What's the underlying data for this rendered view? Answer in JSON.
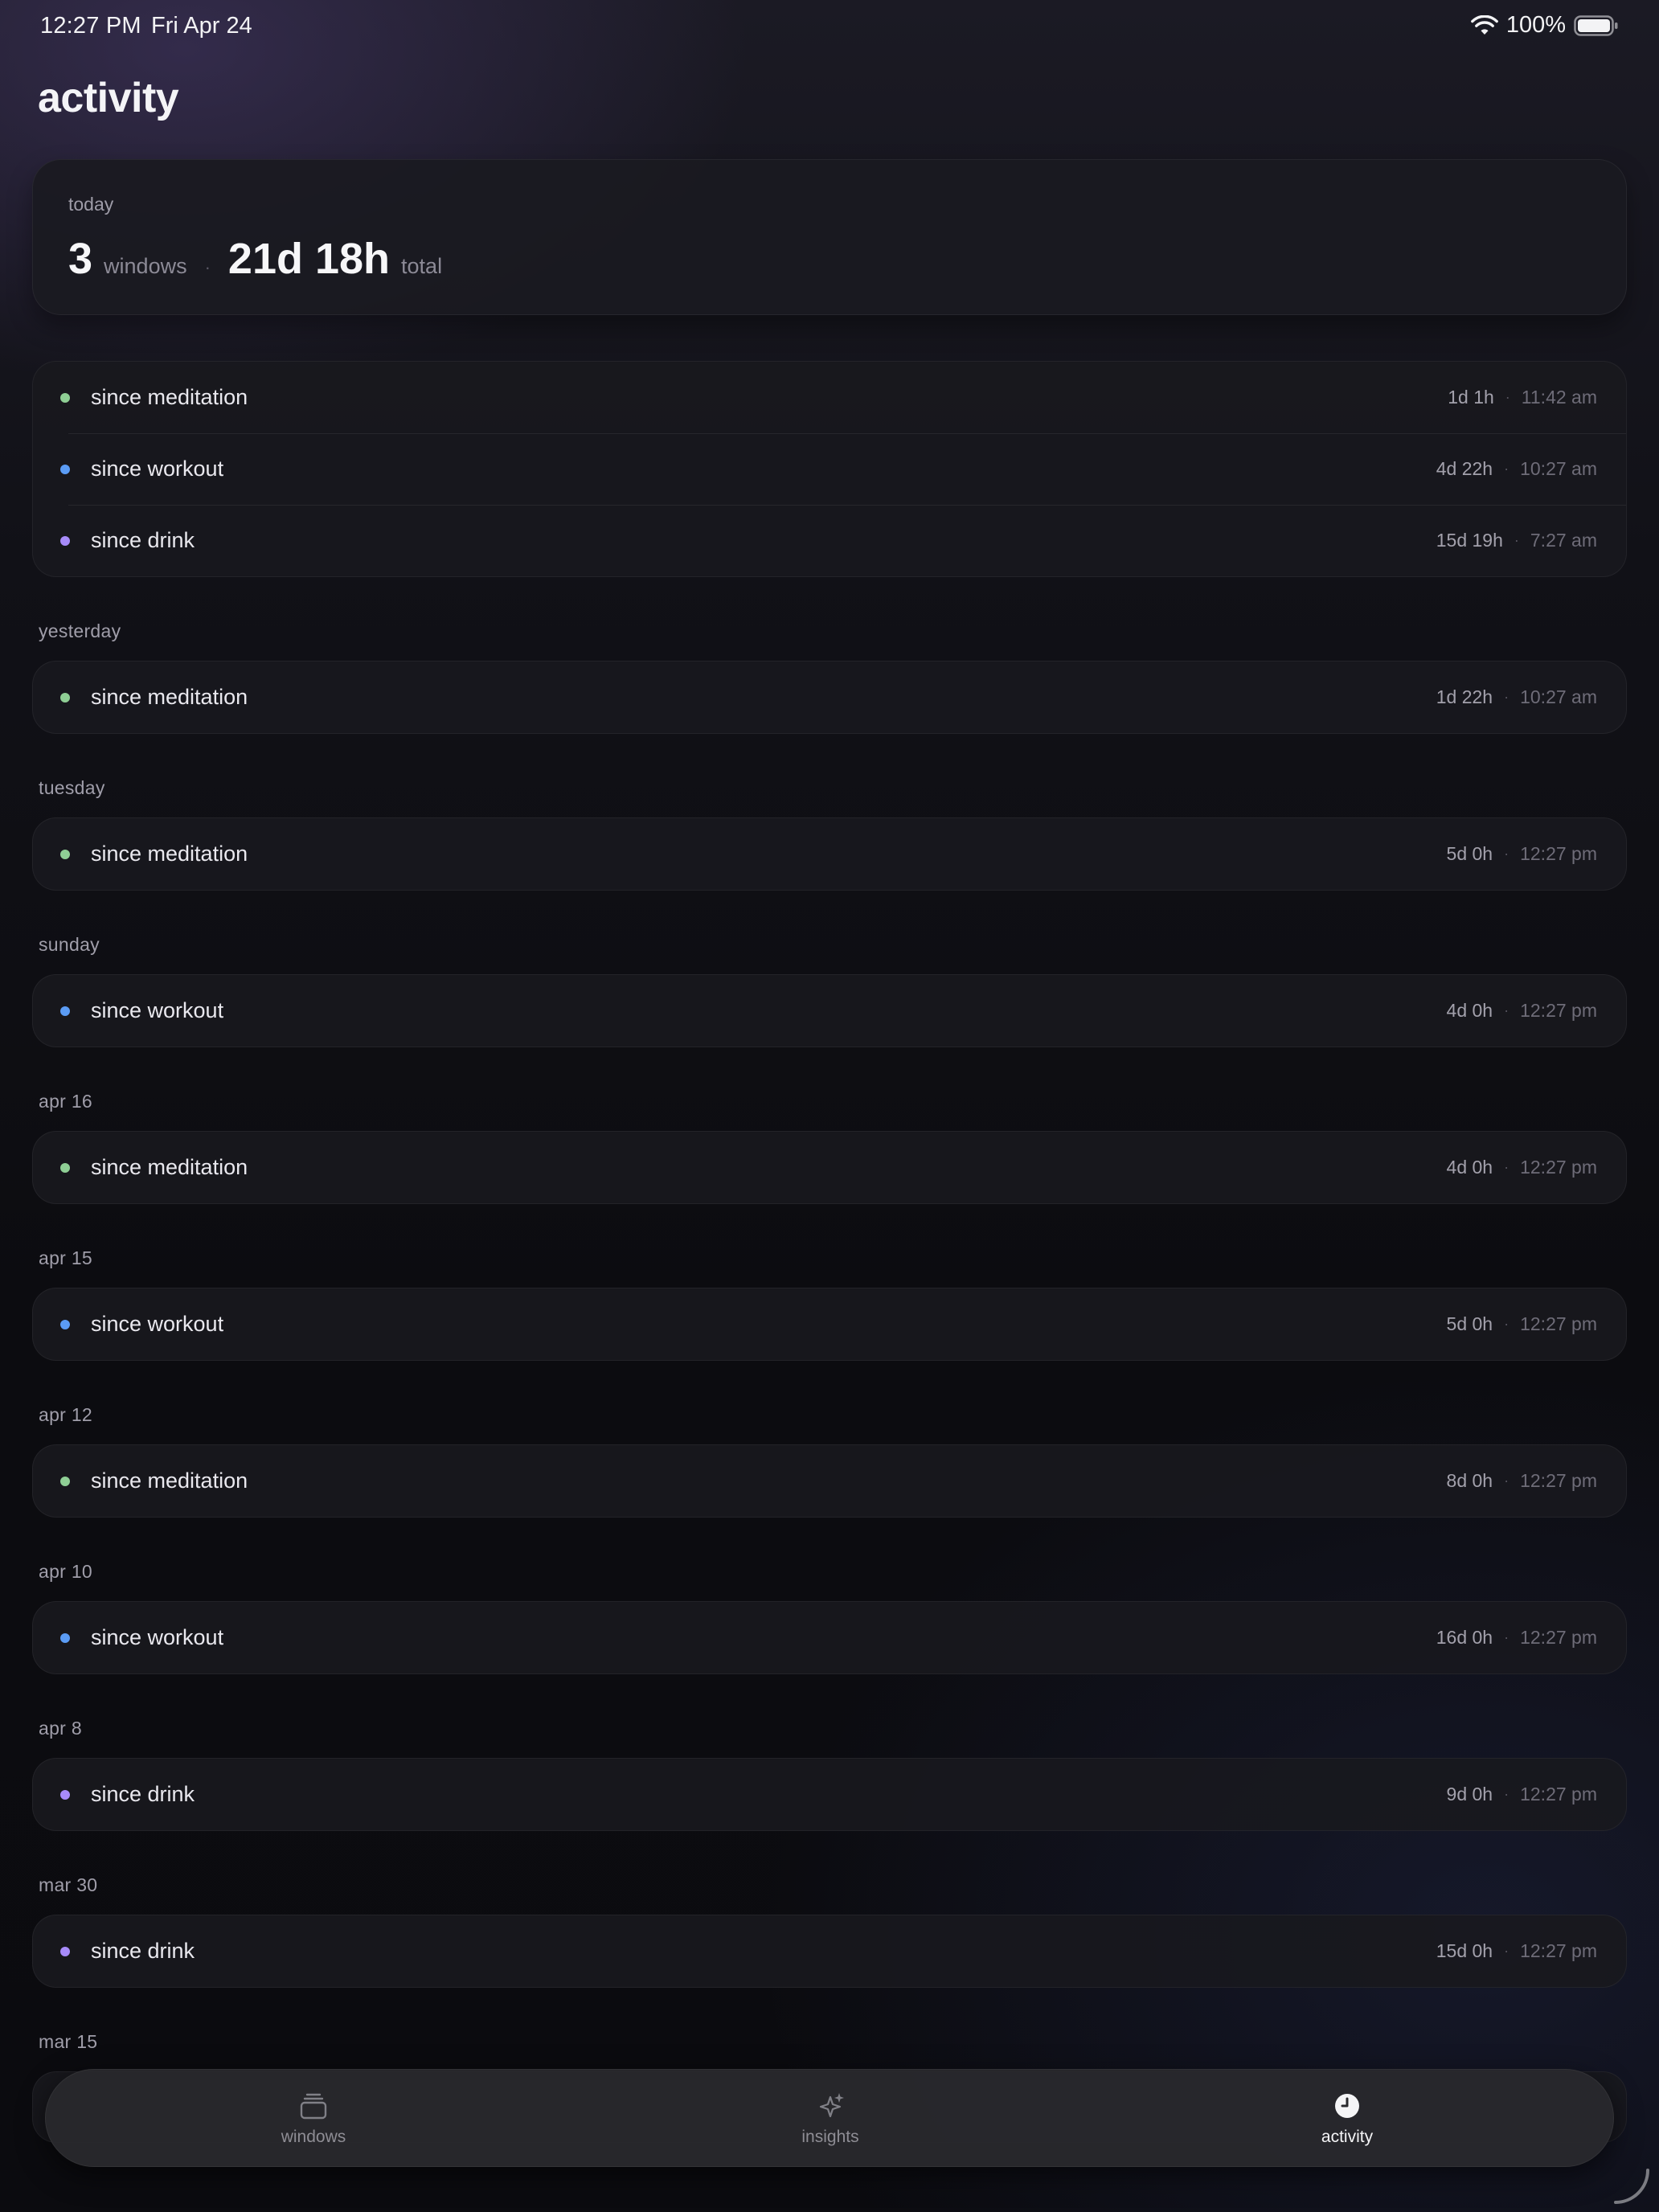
{
  "status_bar": {
    "time": "12:27 PM",
    "date": "Fri Apr 24",
    "battery_pct": "100%",
    "icons": [
      "wifi-icon",
      "battery-icon"
    ]
  },
  "page": {
    "title": "activity"
  },
  "summary": {
    "label": "today",
    "windows_count": "3",
    "windows_unit": "windows",
    "separator": "·",
    "total": "21d 18h",
    "total_unit": "total"
  },
  "colors": {
    "meditation": "#8fcf95",
    "workout": "#5b9cf5",
    "drink": "#a78bfa"
  },
  "sections": [
    {
      "header": "",
      "rows": [
        {
          "label": "since meditation",
          "duration": "1d 1h",
          "time": "11:42 am",
          "kind": "meditation"
        },
        {
          "label": "since workout",
          "duration": "4d 22h",
          "time": "10:27 am",
          "kind": "workout"
        },
        {
          "label": "since drink",
          "duration": "15d 19h",
          "time": "7:27 am",
          "kind": "drink"
        }
      ]
    },
    {
      "header": "yesterday",
      "rows": [
        {
          "label": "since meditation",
          "duration": "1d 22h",
          "time": "10:27 am",
          "kind": "meditation"
        }
      ]
    },
    {
      "header": "tuesday",
      "rows": [
        {
          "label": "since meditation",
          "duration": "5d 0h",
          "time": "12:27 pm",
          "kind": "meditation"
        }
      ]
    },
    {
      "header": "sunday",
      "rows": [
        {
          "label": "since workout",
          "duration": "4d 0h",
          "time": "12:27 pm",
          "kind": "workout"
        }
      ]
    },
    {
      "header": "apr 16",
      "rows": [
        {
          "label": "since meditation",
          "duration": "4d 0h",
          "time": "12:27 pm",
          "kind": "meditation"
        }
      ]
    },
    {
      "header": "apr 15",
      "rows": [
        {
          "label": "since workout",
          "duration": "5d 0h",
          "time": "12:27 pm",
          "kind": "workout"
        }
      ]
    },
    {
      "header": "apr 12",
      "rows": [
        {
          "label": "since meditation",
          "duration": "8d 0h",
          "time": "12:27 pm",
          "kind": "meditation"
        }
      ]
    },
    {
      "header": "apr 10",
      "rows": [
        {
          "label": "since workout",
          "duration": "16d 0h",
          "time": "12:27 pm",
          "kind": "workout"
        }
      ]
    },
    {
      "header": "apr 8",
      "rows": [
        {
          "label": "since drink",
          "duration": "9d 0h",
          "time": "12:27 pm",
          "kind": "drink"
        }
      ]
    },
    {
      "header": "mar 30",
      "rows": [
        {
          "label": "since drink",
          "duration": "15d 0h",
          "time": "12:27 pm",
          "kind": "drink"
        }
      ]
    },
    {
      "header": "mar 15",
      "rows": []
    }
  ],
  "row_separator": "·",
  "tabs": [
    {
      "label": "windows",
      "icon": "stacked-windows-icon",
      "active": false
    },
    {
      "label": "insights",
      "icon": "sparkles-icon",
      "active": false
    },
    {
      "label": "activity",
      "icon": "clock-icon",
      "active": true
    }
  ]
}
